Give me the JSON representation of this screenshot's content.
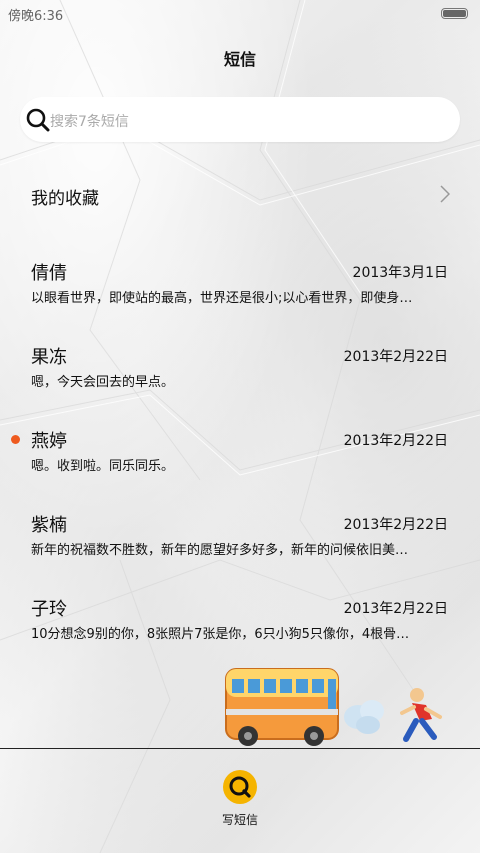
{
  "status_bar": {
    "time": "傍晚6:36"
  },
  "header": {
    "title": "短信"
  },
  "search": {
    "placeholder": "搜索7条短信"
  },
  "favorites": {
    "label": "我的收藏"
  },
  "conversations": [
    {
      "name": "倩倩",
      "date": "2013年3月1日",
      "preview": "以眼看世界，即使站的最高，世界还是很小;以心看世界，即使身…",
      "unread": false
    },
    {
      "name": "果冻",
      "date": "2013年2月22日",
      "preview": "嗯，今天会回去的早点。",
      "unread": false
    },
    {
      "name": "燕婷",
      "date": "2013年2月22日",
      "preview": "嗯。收到啦。同乐同乐。",
      "unread": true
    },
    {
      "name": "紫楠",
      "date": "2013年2月22日",
      "preview": "新年的祝福数不胜数，新年的愿望好多好多，新年的问候依旧美…",
      "unread": false
    },
    {
      "name": "子玲",
      "date": "2013年2月22日",
      "preview": "10分想念9别的你，8张照片7张是你，6只小狗5只像你，4根骨…",
      "unread": false
    }
  ],
  "bottom_bar": {
    "compose_label": "写短信"
  },
  "colors": {
    "unread_dot": "#ee5a1f",
    "compose_accent": "#f5b400"
  },
  "icons": [
    "search-icon",
    "chevron-right-icon",
    "bus-icon",
    "exhaust-cloud-icon",
    "running-person-icon",
    "compose-search-icon",
    "battery-icon"
  ]
}
